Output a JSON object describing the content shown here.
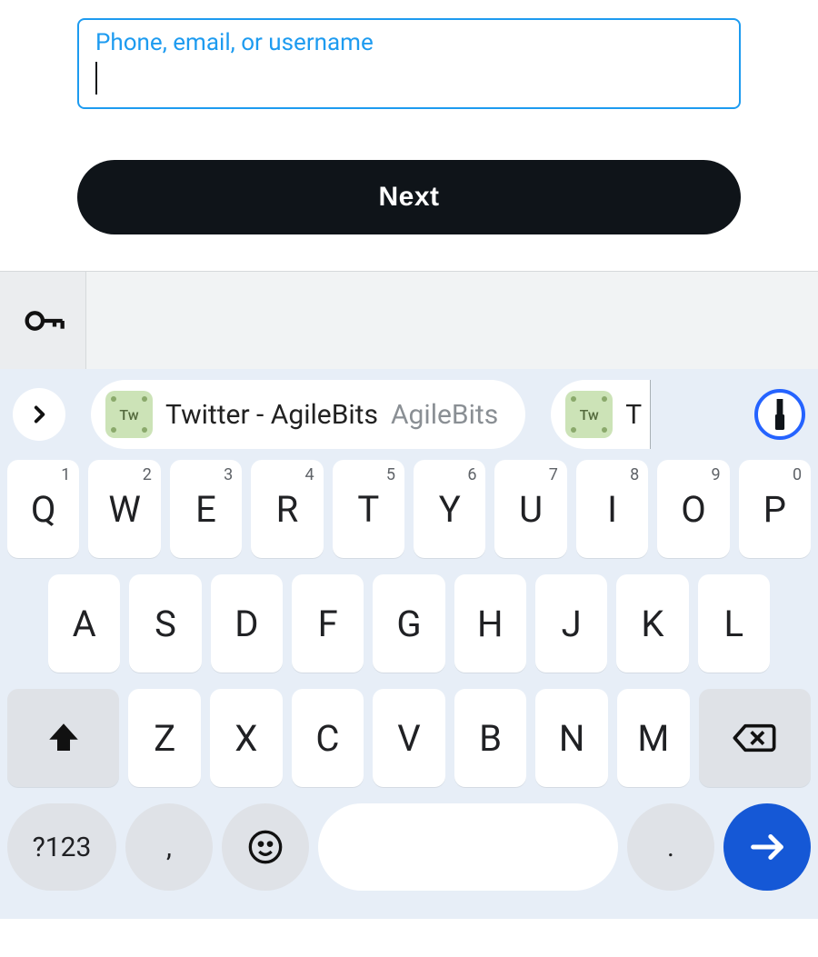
{
  "login": {
    "field_label": "Phone, email, or username",
    "value": "",
    "next_label": "Next"
  },
  "suggestions": {
    "primary_title": "Twitter - AgileBits",
    "primary_subtitle": "AgileBits",
    "secondary_title_fragment": "T",
    "badge_text": "Tw"
  },
  "keyboard": {
    "row1": [
      {
        "k": "Q",
        "n": "1"
      },
      {
        "k": "W",
        "n": "2"
      },
      {
        "k": "E",
        "n": "3"
      },
      {
        "k": "R",
        "n": "4"
      },
      {
        "k": "T",
        "n": "5"
      },
      {
        "k": "Y",
        "n": "6"
      },
      {
        "k": "U",
        "n": "7"
      },
      {
        "k": "I",
        "n": "8"
      },
      {
        "k": "O",
        "n": "9"
      },
      {
        "k": "P",
        "n": "0"
      }
    ],
    "row2": [
      "A",
      "S",
      "D",
      "F",
      "G",
      "H",
      "J",
      "K",
      "L"
    ],
    "row3": [
      "Z",
      "X",
      "C",
      "V",
      "B",
      "N",
      "M"
    ],
    "numeric_label": "?123",
    "comma": ",",
    "period": "."
  }
}
